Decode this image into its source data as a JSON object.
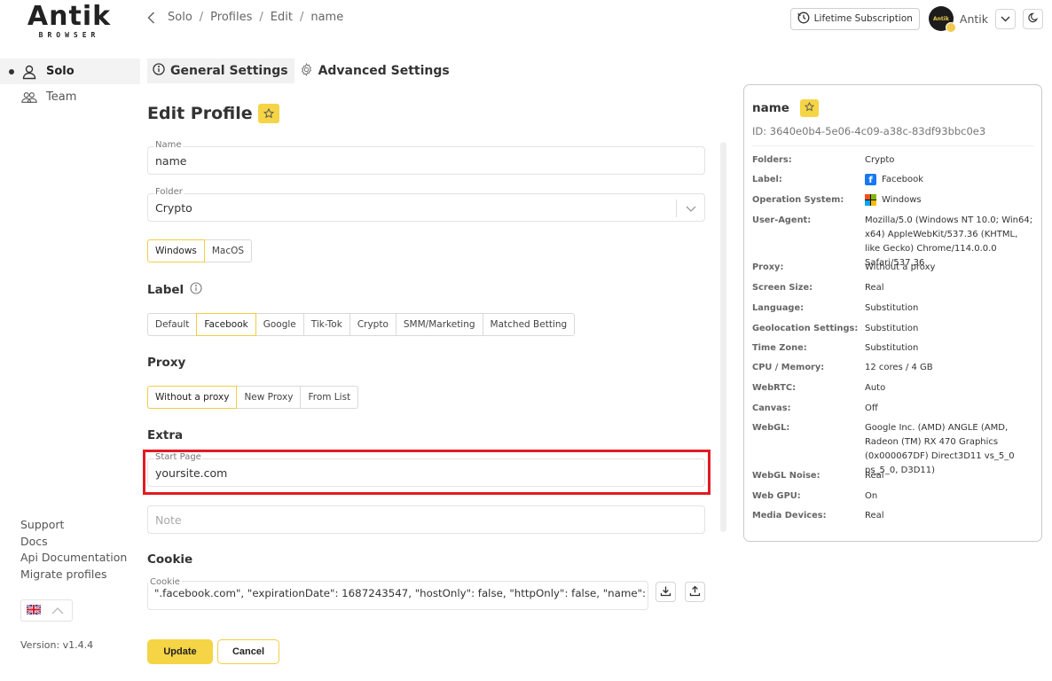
{
  "brand": {
    "name": "Antik",
    "sub": "BROWSER"
  },
  "breadcrumb": [
    "Solo",
    "Profiles",
    "Edit",
    "name"
  ],
  "topbar": {
    "subscription_label": "Lifetime Subscription",
    "user_name": "Antik",
    "avatar_text": "Antik"
  },
  "sidebar": {
    "items": [
      {
        "label": "Solo",
        "icon": "user-icon"
      },
      {
        "label": "Team",
        "icon": "users-icon"
      }
    ],
    "links": [
      "Support",
      "Docs",
      "Api Documentation",
      "Migrate profiles"
    ],
    "language": "uk-flag-icon",
    "version": "Version: v1.4.4"
  },
  "tabs": [
    {
      "label": "General Settings",
      "icon": "info-icon"
    },
    {
      "label": "Advanced Settings",
      "icon": "gear-icon"
    }
  ],
  "form": {
    "title": "Edit Profile",
    "name_label": "Name",
    "name_value": "name",
    "folder_label": "Folder",
    "folder_value": "Crypto",
    "os_options": [
      "Windows",
      "MacOS"
    ],
    "os_selected": "Windows",
    "label_title": "Label",
    "label_options": [
      "Default",
      "Facebook",
      "Google",
      "Tik-Tok",
      "Crypto",
      "SMM/Marketing",
      "Matched Betting"
    ],
    "label_selected": "Facebook",
    "proxy_title": "Proxy",
    "proxy_options": [
      "Without a proxy",
      "New Proxy",
      "From List"
    ],
    "proxy_selected": "Without a proxy",
    "extra_title": "Extra",
    "start_page_label": "Start Page",
    "start_page_value": "yoursite.com",
    "note_placeholder": "Note",
    "cookie_title": "Cookie",
    "cookie_label": "Cookie",
    "cookie_lines": [
      "\".facebook.com\", \"expirationDate\": 1687243547, \"hostOnly\": false, \"httpOnly\": false, \"name\": \"wd\","
    ],
    "update_label": "Update",
    "cancel_label": "Cancel"
  },
  "summary": {
    "name": "name",
    "id": "ID: 3640e0b4-5e06-4c09-a38c-83df93bbc0e3",
    "rows": [
      {
        "key": "Folders:",
        "value": "Crypto"
      },
      {
        "key": "Label:",
        "value": "Facebook",
        "icon": "facebook-icon"
      },
      {
        "key": "Operation System:",
        "value": "Windows",
        "icon": "windows-icon"
      },
      {
        "key": "User-Agent:",
        "value": "Mozilla/5.0 (Windows NT 10.0; Win64; x64) AppleWebKit/537.36 (KHTML, like Gecko) Chrome/114.0.0.0 Safari/537.36"
      },
      {
        "key": "Proxy:",
        "value": "Without a proxy"
      },
      {
        "key": "Screen Size:",
        "value": "Real"
      },
      {
        "key": "Language:",
        "value": "Substitution"
      },
      {
        "key": "Geolocation Settings:",
        "value": "Substitution"
      },
      {
        "key": "Time Zone:",
        "value": "Substitution"
      },
      {
        "key": "CPU / Memory:",
        "value": "12 cores / 4 GB"
      },
      {
        "key": "WebRTC:",
        "value": "Auto"
      },
      {
        "key": "Canvas:",
        "value": "Off"
      },
      {
        "key": "WebGL:",
        "value": "Google Inc. (AMD) ANGLE (AMD, Radeon (TM) RX 470 Graphics (0x000067DF) Direct3D11 vs_5_0 ps_5_0, D3D11)"
      },
      {
        "key": "WebGL Noise:",
        "value": "Real"
      },
      {
        "key": "Web GPU:",
        "value": "On"
      },
      {
        "key": "Media Devices:",
        "value": "Real"
      }
    ]
  },
  "colors": {
    "accent": "#f5d445",
    "highlight": "#e31b23",
    "facebook": "#1877f2"
  }
}
